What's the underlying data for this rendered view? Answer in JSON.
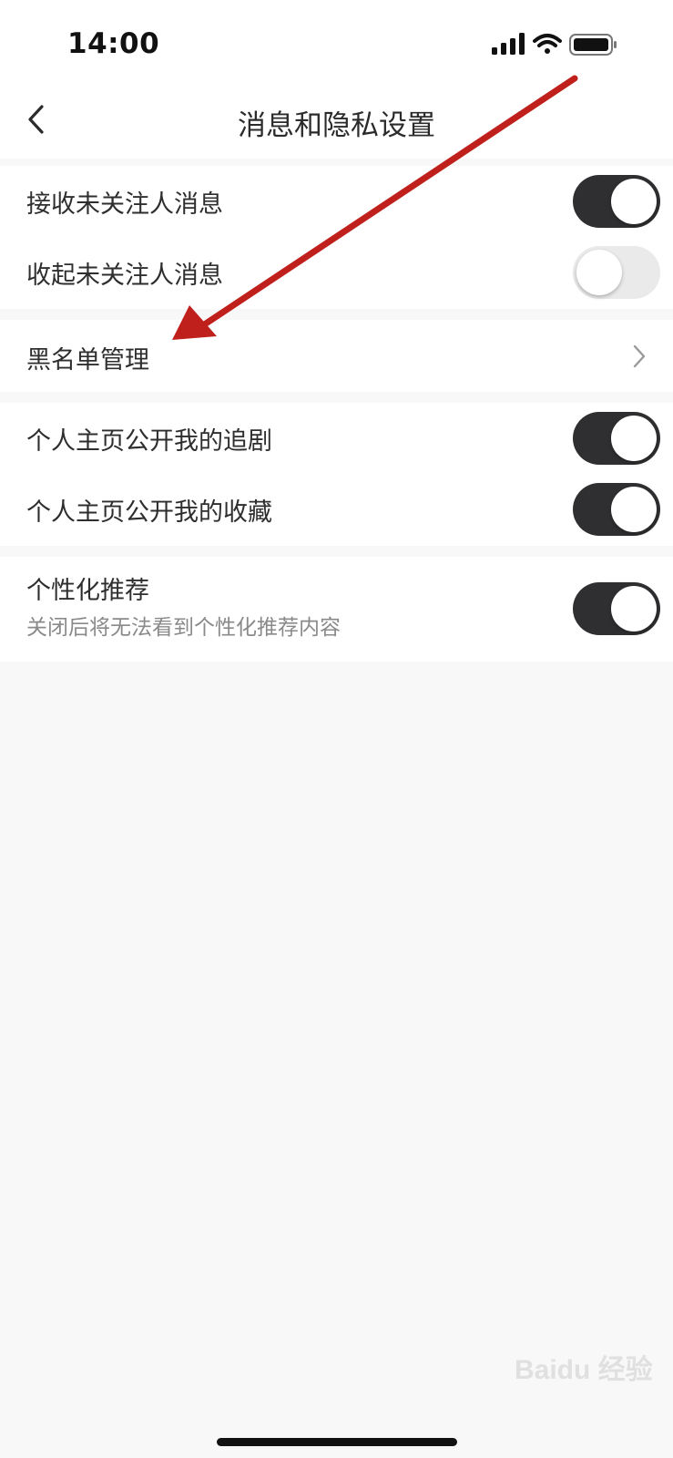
{
  "status_bar": {
    "time": "14:00",
    "icons": [
      "cellular-signal-icon",
      "wifi-icon",
      "battery-icon"
    ]
  },
  "nav": {
    "title": "消息和隐私设置",
    "back_icon": "chevron-left-icon"
  },
  "groups": [
    {
      "items": [
        {
          "label": "接收未关注人消息",
          "control": "toggle",
          "state": "on"
        },
        {
          "label": "收起未关注人消息",
          "control": "toggle",
          "state": "off"
        }
      ]
    },
    {
      "items": [
        {
          "label": "黑名单管理",
          "control": "chevron-right-icon"
        }
      ]
    },
    {
      "items": [
        {
          "label": "个人主页公开我的追剧",
          "control": "toggle",
          "state": "on"
        },
        {
          "label": "个人主页公开我的收藏",
          "control": "toggle",
          "state": "on"
        }
      ]
    },
    {
      "items": [
        {
          "label": "个性化推荐",
          "sublabel": "关闭后将无法看到个性化推荐内容",
          "control": "toggle",
          "state": "on"
        }
      ]
    }
  ],
  "annotation": {
    "type": "red-arrow",
    "color": "#c0201c"
  },
  "watermark": "Baidu 经验",
  "colors": {
    "toggle_on": "#2f2f31",
    "toggle_off": "#eaeaea",
    "background": "#f8f8f8",
    "annotation": "#c0201c"
  }
}
